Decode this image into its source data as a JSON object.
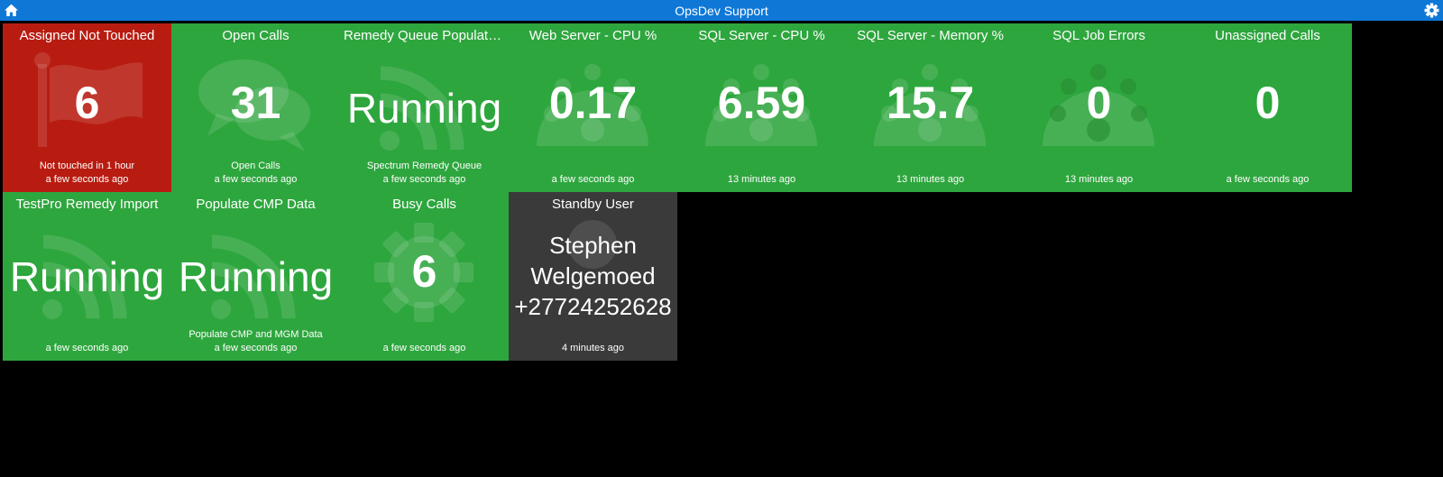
{
  "header": {
    "title": "OpsDev Support",
    "home_icon": "home-icon",
    "settings_icon": "gear-icon",
    "color": "#0f78d7"
  },
  "colors": {
    "green": "#2ea63e",
    "red": "#b81c11",
    "dark": "#3a3a3a"
  },
  "tiles": [
    {
      "title": "Assigned Not Touched",
      "value": "6",
      "more": "Not touched in 1 hour",
      "updated": "a few seconds ago",
      "status": "red",
      "icon": "flag-icon"
    },
    {
      "title": "Open Calls",
      "value": "31",
      "more": "Open Calls",
      "updated": "a few seconds ago",
      "status": "green",
      "icon": "chat-icon"
    },
    {
      "title": "Remedy Queue Populate...",
      "value": "Running",
      "more": "Spectrum Remedy Queue",
      "updated": "a few seconds ago",
      "status": "green",
      "icon": "rss-icon"
    },
    {
      "title": "Web Server - CPU %",
      "value": "0.17",
      "more": "",
      "updated": "a few seconds ago",
      "status": "green",
      "icon": "dashboard-icon"
    },
    {
      "title": "SQL Server - CPU %",
      "value": "6.59",
      "more": "",
      "updated": "13 minutes ago",
      "status": "green",
      "icon": "dashboard-icon"
    },
    {
      "title": "SQL Server - Memory %",
      "value": "15.7",
      "more": "",
      "updated": "13 minutes ago",
      "status": "green",
      "icon": "dashboard-icon"
    },
    {
      "title": "SQL Job Errors",
      "value": "0",
      "more": "",
      "updated": "13 minutes ago",
      "status": "green",
      "icon": "dashboard-icon"
    },
    {
      "title": "Unassigned Calls",
      "value": "0",
      "more": "",
      "updated": "a few seconds ago",
      "status": "green",
      "icon": ""
    },
    {
      "title": "TestPro Remedy Import",
      "value": "Running",
      "more": "",
      "updated": "a few seconds ago",
      "status": "green",
      "icon": "rss-icon"
    },
    {
      "title": "Populate CMP Data",
      "value": "Running",
      "more": "Populate CMP and MGM Data",
      "updated": "a few seconds ago",
      "status": "green",
      "icon": "rss-icon"
    },
    {
      "title": "Busy Calls",
      "value": "6",
      "more": "",
      "updated": "a few seconds ago",
      "status": "green",
      "icon": "cog-icon"
    },
    {
      "title": "Standby User",
      "value_lines": [
        "Stephen",
        "Welgemoed",
        "+27724252628"
      ],
      "more": "",
      "updated": "4 minutes ago",
      "status": "dark",
      "icon": "user-icon"
    }
  ]
}
